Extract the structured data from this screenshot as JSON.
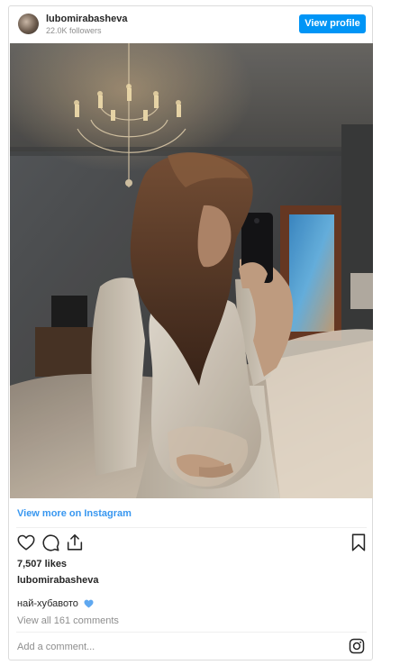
{
  "post": {
    "username": "lubomirabasheva",
    "followers": "22.0K followers",
    "view_profile_label": "View profile",
    "view_more_label": "View more on Instagram",
    "likes": "7,507 likes",
    "caption_username": "lubomirabasheva",
    "caption_text": "най-хубавото",
    "caption_emoji": "blue-heart-icon",
    "comments_link": "View all 161 comments",
    "comment_placeholder": "Add a comment..."
  },
  "icons": {
    "like": "heart-icon",
    "comment": "comment-icon",
    "share": "share-icon",
    "save": "bookmark-icon",
    "instagram": "instagram-icon"
  },
  "colors": {
    "accent": "#0095f6",
    "link": "#3897f0",
    "secondary_text": "#8e8e8e",
    "border": "#dbdbdb",
    "heart": "#5fa8f0"
  }
}
